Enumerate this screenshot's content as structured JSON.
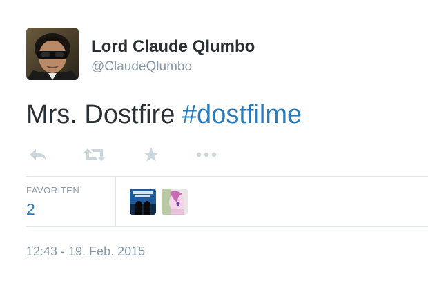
{
  "author": {
    "display_name": "Lord Claude Qlumbo",
    "handle": "@ClaudeQlumbo",
    "avatar_icon": "man-with-sunglasses-avatar"
  },
  "tweet": {
    "text_plain": "Mrs. Dostfire",
    "text_hashtag": "#dostfilme"
  },
  "actions": [
    {
      "name": "reply",
      "icon": "reply-icon"
    },
    {
      "name": "retweet",
      "icon": "retweet-icon"
    },
    {
      "name": "favorite",
      "icon": "star-icon"
    },
    {
      "name": "more",
      "icon": "more-icon"
    }
  ],
  "stats": {
    "favorites_label": "FAVORITEN",
    "favorites_count": "2",
    "favoriters": [
      {
        "icon": "blues-brothers-avatar"
      },
      {
        "icon": "pink-pony-avatar"
      }
    ]
  },
  "timestamp": "12:43 - 19. Feb. 2015",
  "colors": {
    "link": "#2b7bb9",
    "text": "#292f33",
    "muted": "#8899a6",
    "action_icon": "#ccd6dd",
    "divider": "#e1e8ed"
  }
}
